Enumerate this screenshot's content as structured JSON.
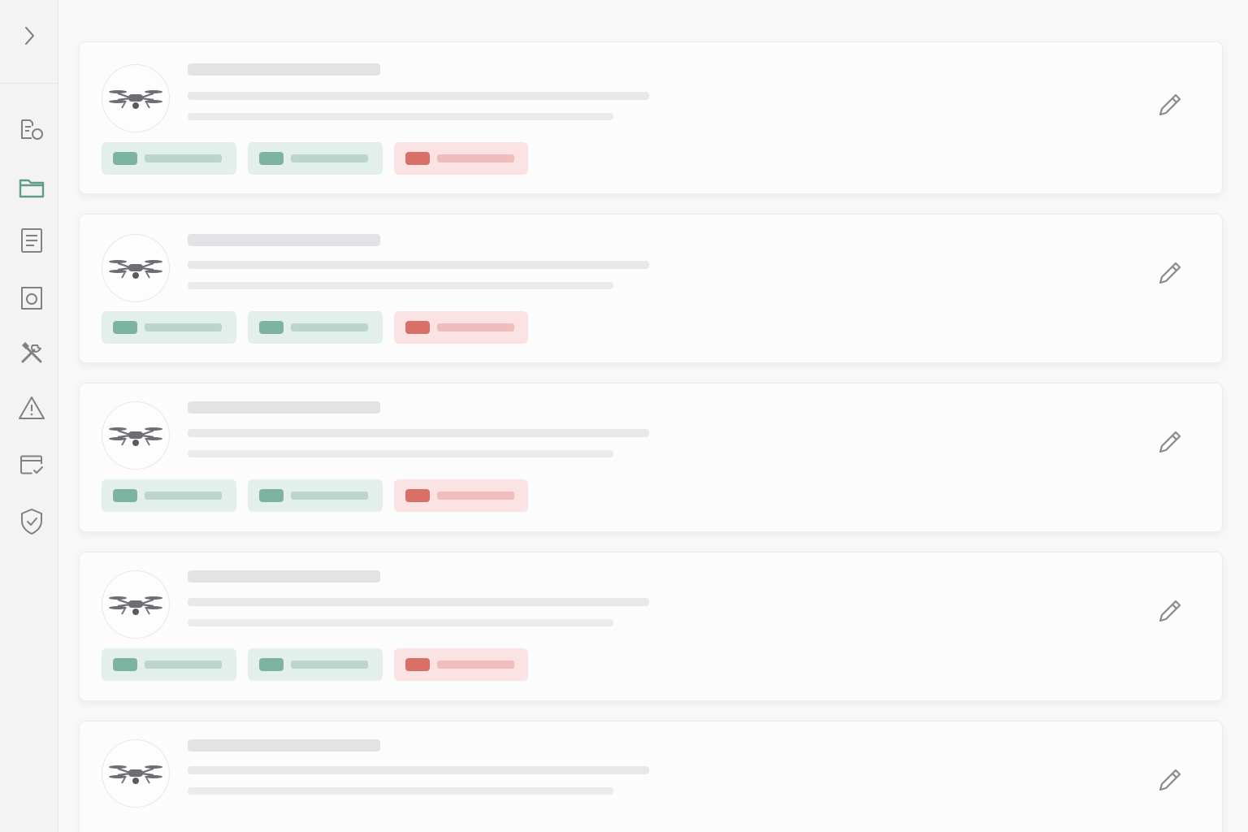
{
  "sidebar": {
    "expand_icon": "chevron-right-icon",
    "items": [
      {
        "icon": "list-settings-icon",
        "active": false
      },
      {
        "icon": "folder-icon",
        "active": true
      },
      {
        "icon": "document-icon",
        "active": false
      },
      {
        "icon": "camera-icon",
        "active": false
      },
      {
        "icon": "tools-icon",
        "active": false
      },
      {
        "icon": "warning-icon",
        "active": false
      },
      {
        "icon": "card-check-icon",
        "active": false
      },
      {
        "icon": "shield-check-icon",
        "active": false
      }
    ],
    "accent_color": "#5f9d88"
  },
  "cards": [
    {
      "avatar_icon": "drone-icon",
      "tags": [
        "green",
        "green",
        "red"
      ],
      "action_icon": "pencil-icon"
    },
    {
      "avatar_icon": "drone-icon",
      "tags": [
        "green",
        "green",
        "red"
      ],
      "action_icon": "pencil-icon"
    },
    {
      "avatar_icon": "drone-icon",
      "tags": [
        "green",
        "green",
        "red"
      ],
      "action_icon": "pencil-icon"
    },
    {
      "avatar_icon": "drone-icon",
      "tags": [
        "green",
        "green",
        "red"
      ],
      "action_icon": "pencil-icon"
    },
    {
      "avatar_icon": "drone-icon",
      "tags": [],
      "action_icon": "pencil-icon"
    }
  ],
  "colors": {
    "tag_green": "#7db49f",
    "tag_red": "#d97068",
    "skeleton": "#e3e3e6"
  }
}
